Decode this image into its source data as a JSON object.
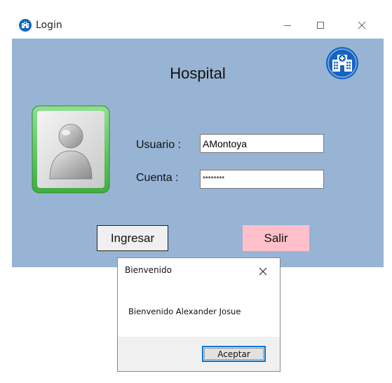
{
  "window": {
    "title": "Login",
    "icon": "hospital-app-icon",
    "controls": [
      "minimize-icon",
      "maximize-icon",
      "close-icon"
    ]
  },
  "form": {
    "heading": "Hospital",
    "logo_icon": "hospital-building-icon",
    "avatar_icon": "user-avatar-icon",
    "user_label": "Usuario :",
    "user_value": "AMontoya",
    "password_label": "Cuenta :",
    "password_value": "********",
    "login_button": "Ingresar",
    "exit_button": "Salir"
  },
  "dialog": {
    "title": "Bienvenido",
    "message": "Bienvenido Alexander Josue",
    "ok_button": "Aceptar"
  },
  "colors": {
    "client_background": "#98b4d4",
    "logo_circle": "#1565c0",
    "exit_button_bg": "#ffc0cb",
    "focus_border": "#0078d7",
    "avatar_frame": "#5cc85c"
  }
}
